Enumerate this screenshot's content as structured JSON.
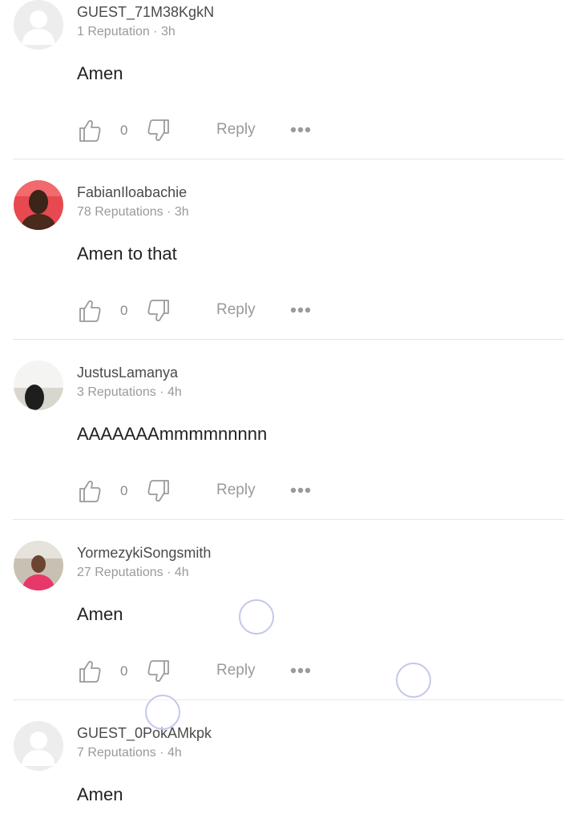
{
  "comments": [
    {
      "username": "GUEST_71M38KgkN",
      "meta": "1 Reputation · 3h",
      "text": "Amen",
      "likes": "0",
      "reply_label": "Reply",
      "avatar": "default-avatar"
    },
    {
      "username": "FabianIloabachie",
      "meta": "78 Reputations · 3h",
      "text": "Amen to that",
      "likes": "0",
      "reply_label": "Reply",
      "avatar": "photo-avatar"
    },
    {
      "username": "JustusLamanya",
      "meta": "3 Reputations · 4h",
      "text": "AAAAAAAmmmmnnnnn",
      "likes": "0",
      "reply_label": "Reply",
      "avatar": "photo-avatar"
    },
    {
      "username": "YormezykiSongsmith",
      "meta": "27 Reputations · 4h",
      "text": "Amen",
      "likes": "0",
      "reply_label": "Reply",
      "avatar": "photo-avatar"
    },
    {
      "username": "GUEST_0PokAMkpk",
      "meta": "7 Reputations · 4h",
      "text": "Amen",
      "likes": "",
      "reply_label": "",
      "avatar": "default-avatar"
    }
  ],
  "icons": {
    "like": "thumbs-up-icon",
    "dislike": "thumbs-down-icon",
    "more": "more-dots-icon"
  },
  "colors": {
    "text_primary": "#222222",
    "text_secondary": "#9a9a9a",
    "divider": "#e6e6e6",
    "touch_ripple": "#c3c7ea"
  }
}
